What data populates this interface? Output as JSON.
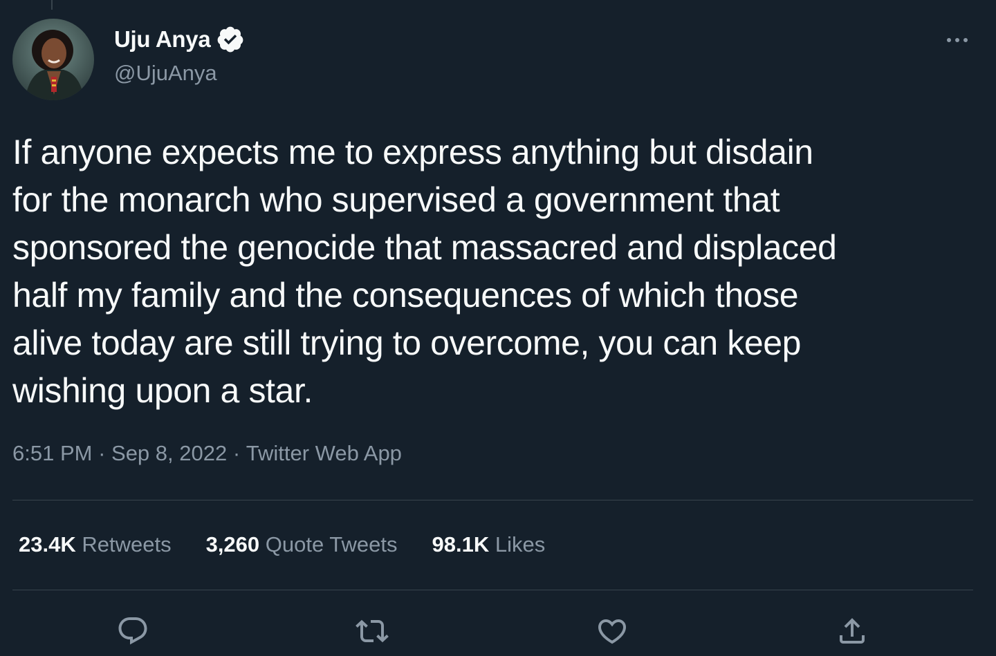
{
  "user": {
    "display_name": "Uju Anya",
    "handle": "@UjuAnya",
    "verified": true,
    "avatar": "profile-photo"
  },
  "tweet": {
    "text": "If anyone expects me to express anything but disdain\nfor the monarch who supervised a government that\nsponsored the genocide that massacred and displaced\nhalf my family and the consequences of which those\nalive today are still trying to overcome, you can keep\nwishing upon a star.",
    "time": "6:51 PM",
    "separator": " · ",
    "date": "Sep 8, 2022",
    "source": "Twitter Web App"
  },
  "stats": {
    "retweets": {
      "count": "23.4K",
      "label": " Retweets"
    },
    "quotes": {
      "count": "3,260",
      "label": " Quote Tweets"
    },
    "likes": {
      "count": "98.1K",
      "label": " Likes"
    }
  },
  "actions": [
    "reply-icon",
    "retweet-icon",
    "like-icon",
    "share-icon"
  ],
  "colors": {
    "background": "#15202b",
    "text": "#f7f9f9",
    "secondary": "#8b98a5",
    "divider": "#38444d"
  }
}
